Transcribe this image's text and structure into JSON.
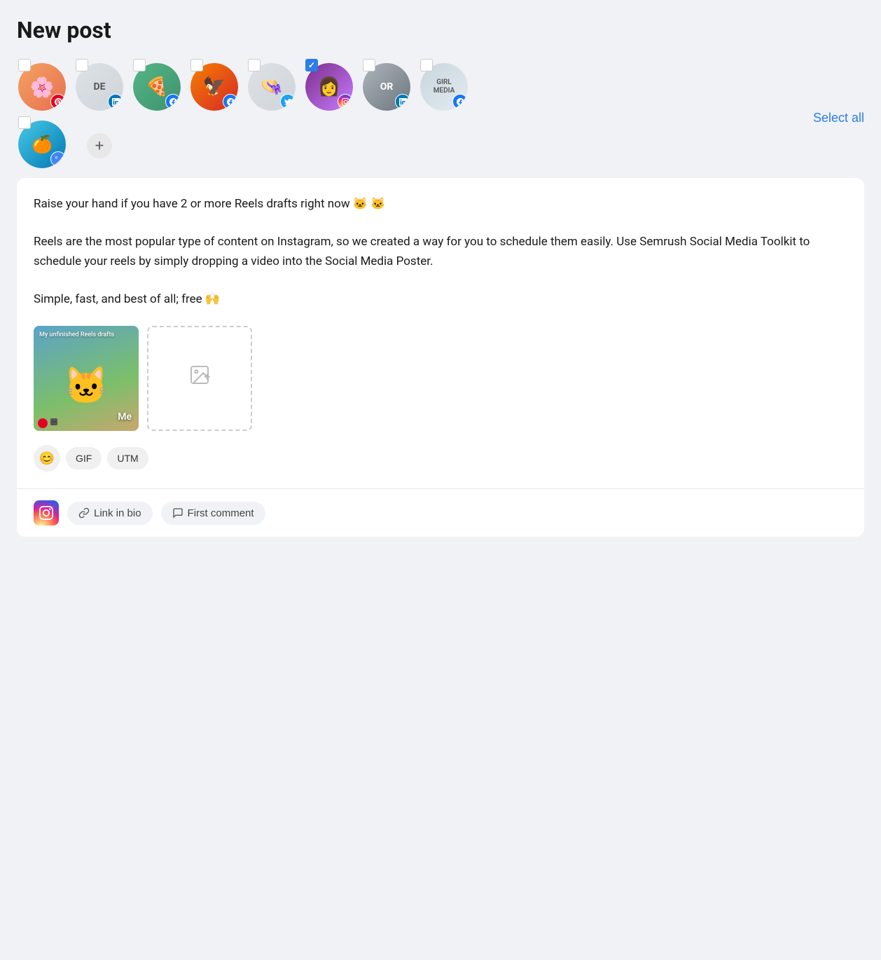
{
  "page": {
    "title": "New post"
  },
  "select_all": "Select all",
  "accounts": [
    {
      "id": "acc1",
      "initials": "",
      "color": "av-pink",
      "social": "pinterest",
      "checked": false,
      "label": "Pinterest account 1"
    },
    {
      "id": "acc2",
      "initials": "DE",
      "color": "av-light",
      "social": "linkedin",
      "checked": false,
      "label": "DE LinkedIn"
    },
    {
      "id": "acc3",
      "initials": "",
      "color": "av-green",
      "social": "facebook",
      "checked": false,
      "label": "Facebook page"
    },
    {
      "id": "acc4",
      "initials": "",
      "color": "av-orange",
      "social": "facebook",
      "checked": false,
      "label": "Facebook page 2"
    },
    {
      "id": "acc5",
      "initials": "",
      "color": "av-light",
      "social": "twitter",
      "checked": false,
      "label": "Twitter account"
    },
    {
      "id": "acc6",
      "initials": "",
      "color": "av-purple",
      "social": "instagram",
      "checked": true,
      "label": "Instagram account"
    },
    {
      "id": "acc7",
      "initials": "OR",
      "color": "av-gray",
      "social": "linkedin",
      "checked": false,
      "label": "OR LinkedIn"
    },
    {
      "id": "acc8",
      "initials": "",
      "color": "av-light",
      "social": "facebook",
      "checked": false,
      "label": "Girl Media Facebook"
    }
  ],
  "accounts_row2": [
    {
      "id": "acc9",
      "initials": "",
      "color": "av-teal",
      "social": "gmb",
      "checked": false,
      "label": "GMB account"
    }
  ],
  "add_account_label": "+",
  "post": {
    "text": "Raise your hand if you have 2 or more Reels drafts right now 🐱 🐱\n\nReels are the most popular type of content on Instagram, so we created a way for you to schedule them easily. Use Semrush Social Media Toolkit to schedule your reels by simply dropping a video into the Social Media Poster.\n\nSimple, fast, and best of all; free 🙌",
    "cat_label": "My unfinished Reels drafts",
    "cat_me": "Me"
  },
  "toolbar": {
    "emoji_label": "😊",
    "gif_label": "GIF",
    "utm_label": "UTM"
  },
  "bottom_bar": {
    "link_in_bio": "Link in bio",
    "first_comment": "First comment"
  }
}
